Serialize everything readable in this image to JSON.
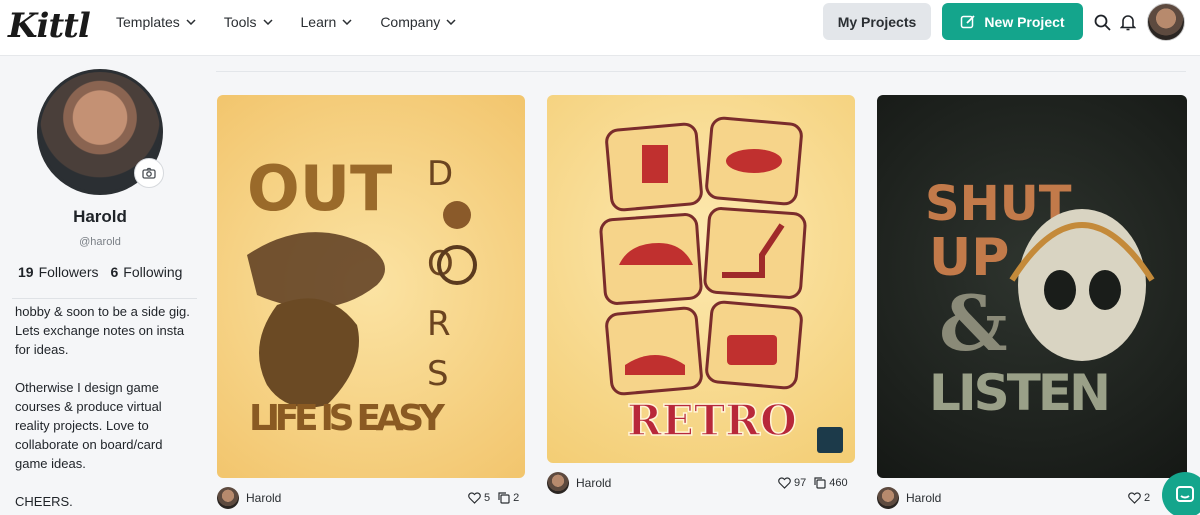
{
  "brand": {
    "logo_text": "Kittl"
  },
  "nav": [
    {
      "label": "Templates"
    },
    {
      "label": "Tools"
    },
    {
      "label": "Learn"
    },
    {
      "label": "Company"
    }
  ],
  "header": {
    "my_projects_label": "My Projects",
    "new_project_label": "New Project"
  },
  "profile": {
    "name": "Harold",
    "handle": "@harold",
    "followers_count": "19",
    "followers_label": "Followers",
    "following_count": "6",
    "following_label": "Following",
    "bio": [
      "hobby  & soon to be a side gig. Lets exchange notes on insta for ideas.",
      "Otherwise I design game courses & produce virtual reality projects. Love to collaborate on board/card game ideas.",
      "CHEERS."
    ]
  },
  "cards": [
    {
      "author": "Harold",
      "likes": "5",
      "copies": "2",
      "art_lines": [
        "OUT",
        "D",
        "O",
        "R",
        "S",
        "LIFE IS EASY"
      ]
    },
    {
      "author": "Harold",
      "likes": "97",
      "copies": "460",
      "art_lines": [
        "RETRO"
      ]
    },
    {
      "author": "Harold",
      "likes": "2",
      "copies": "",
      "art_lines": [
        "SHUT",
        "UP",
        "&",
        "LISTEN"
      ]
    }
  ],
  "colors": {
    "accent": "#14a58c"
  }
}
